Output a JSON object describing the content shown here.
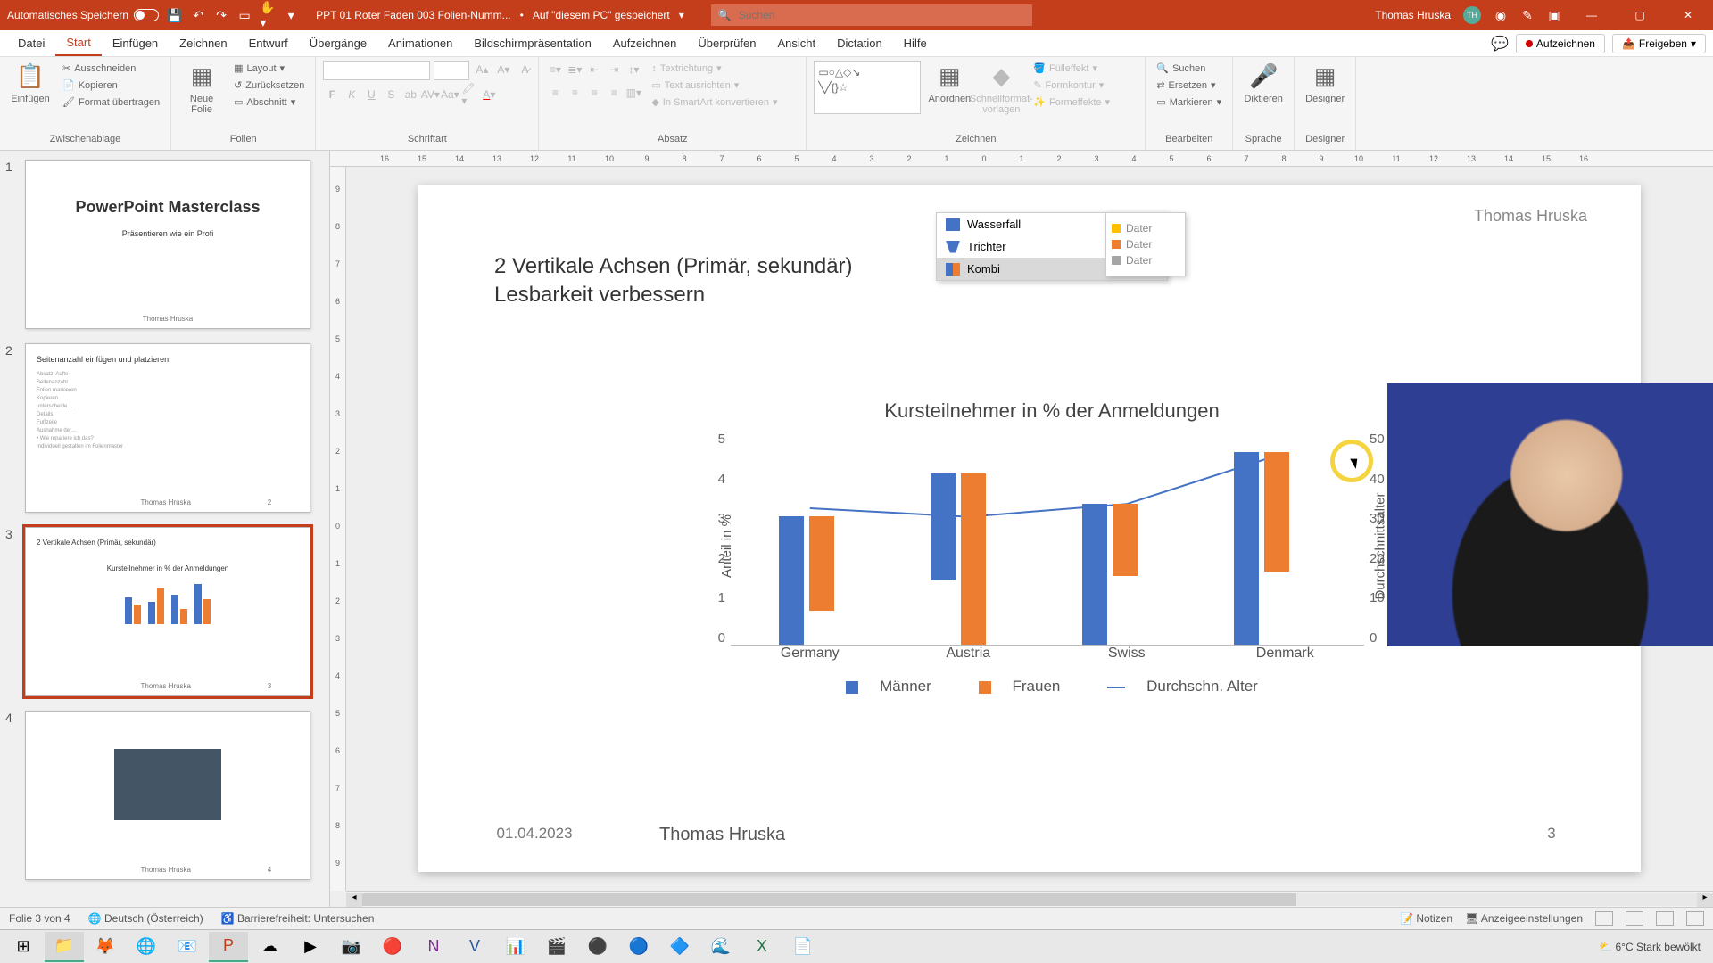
{
  "titlebar": {
    "autosave": "Automatisches Speichern",
    "filename": "PPT 01 Roter Faden 003 Folien-Numm...",
    "saved_location": "Auf \"diesem PC\" gespeichert",
    "search_placeholder": "Suchen",
    "user": "Thomas Hruska",
    "user_initials": "TH"
  },
  "ribbon": {
    "tabs": [
      "Datei",
      "Start",
      "Einfügen",
      "Zeichnen",
      "Entwurf",
      "Übergänge",
      "Animationen",
      "Bildschirmpräsentation",
      "Aufzeichnen",
      "Überprüfen",
      "Ansicht",
      "Dictation",
      "Hilfe"
    ],
    "active_tab": "Start",
    "record": "Aufzeichnen",
    "share": "Freigeben",
    "groups": {
      "zwischenablage": {
        "label": "Zwischenablage",
        "paste": "Einfügen",
        "cut": "Ausschneiden",
        "copy": "Kopieren",
        "format": "Format übertragen"
      },
      "folien": {
        "label": "Folien",
        "new": "Neue\nFolie",
        "layout": "Layout",
        "reset": "Zurücksetzen",
        "section": "Abschnitt"
      },
      "schriftart": {
        "label": "Schriftart"
      },
      "absatz": {
        "label": "Absatz",
        "textdir": "Textrichtung",
        "textalign": "Text ausrichten",
        "smartart": "In SmartArt konvertieren"
      },
      "zeichnen": {
        "label": "Zeichnen",
        "arrange": "Anordnen",
        "quickstyles": "Schnellformat-\nvorlagen",
        "fill": "Fülleffekt",
        "outline": "Formkontur",
        "effects": "Formeffekte"
      },
      "bearbeiten": {
        "label": "Bearbeiten",
        "find": "Suchen",
        "replace": "Ersetzen",
        "select": "Markieren"
      },
      "sprache": {
        "label": "Sprache",
        "dictate": "Diktieren"
      },
      "designer": {
        "label": "Designer",
        "btn": "Designer"
      }
    }
  },
  "thumbnails": {
    "slides": [
      {
        "num": "1",
        "title": "PowerPoint Masterclass",
        "sub": "Präsentieren wie ein Profi",
        "foot": "Thomas Hruska"
      },
      {
        "num": "2",
        "title": "Seitenanzahl einfügen und platzieren",
        "foot": "Thomas Hruska"
      },
      {
        "num": "3",
        "title": "2 Vertikale Achsen (Primär, sekundär)",
        "foot": "Thomas Hruska"
      },
      {
        "num": "4",
        "title": "",
        "foot": "Thomas Hruska"
      }
    ],
    "selected": 3
  },
  "slide": {
    "author_top": "Thomas Hruska",
    "title_line1": "2 Vertikale Achsen (Primär, sekundär)",
    "title_line2": "Lesbarkeit verbessern",
    "chart_menu": {
      "wasserfall": "Wasserfall",
      "trichter": "Trichter",
      "kombi": "Kombi"
    },
    "legend_items": [
      "Dater",
      "Dater",
      "Dater"
    ],
    "footer_date": "01.04.2023",
    "footer_name": "Thomas Hruska",
    "footer_page": "3"
  },
  "chart_data": {
    "type": "bar",
    "title": "Kursteilnehmer in % der Anmeldungen",
    "categories": [
      "Germany",
      "Austria",
      "Swiss",
      "Denmark"
    ],
    "series": [
      {
        "name": "Männer",
        "values": [
          3.0,
          2.5,
          3.3,
          4.5
        ],
        "color": "#4472c4"
      },
      {
        "name": "Frauen",
        "values": [
          2.2,
          4.0,
          1.7,
          2.8
        ],
        "color": "#ed7d31"
      },
      {
        "name": "Durchschn. Alter",
        "values": [
          32,
          30,
          33,
          45
        ],
        "axis": "secondary",
        "type": "line",
        "color": "#4472c4"
      }
    ],
    "ylabel": "Anteil in %",
    "ylabel2": "Durchschnittsalter",
    "ylim": [
      0,
      5
    ],
    "ylim2": [
      0,
      50
    ],
    "yticks": [
      "5",
      "4",
      "3",
      "2",
      "1",
      "0"
    ],
    "yticks2": [
      "50",
      "40",
      "30",
      "20",
      "10",
      "0"
    ]
  },
  "statusbar": {
    "slide_pos": "Folie 3 von 4",
    "language": "Deutsch (Österreich)",
    "accessibility": "Barrierefreiheit: Untersuchen",
    "notes": "Notizen",
    "display": "Anzeigeeinstellungen"
  },
  "taskbar": {
    "weather_temp": "6°C",
    "weather_text": "Stark bewölkt"
  },
  "ruler_h": [
    "16",
    "15",
    "14",
    "13",
    "12",
    "11",
    "10",
    "9",
    "8",
    "7",
    "6",
    "5",
    "4",
    "3",
    "2",
    "1",
    "0",
    "1",
    "2",
    "3",
    "4",
    "5",
    "6",
    "7",
    "8",
    "9",
    "10",
    "11",
    "12",
    "13",
    "14",
    "15",
    "16"
  ],
  "ruler_v": [
    "9",
    "8",
    "7",
    "6",
    "5",
    "4",
    "3",
    "2",
    "1",
    "0",
    "1",
    "2",
    "3",
    "4",
    "5",
    "6",
    "7",
    "8",
    "9"
  ]
}
